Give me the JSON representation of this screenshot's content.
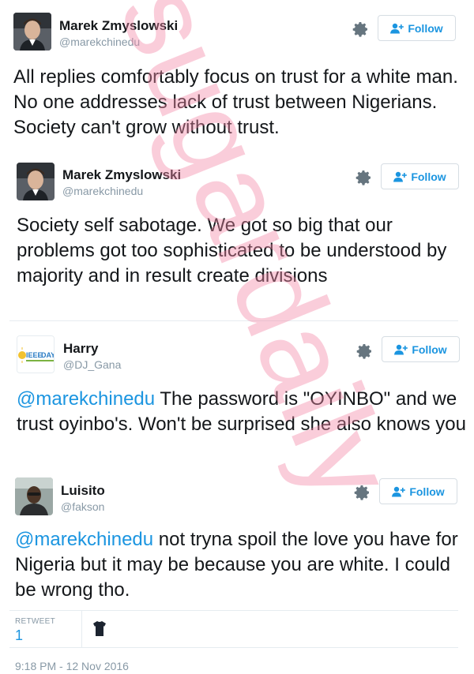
{
  "tweets": [
    {
      "name": "Marek Zmyslowski",
      "handle": "@marekchinedu",
      "follow_label": "Follow",
      "mention": "",
      "text": "All replies comfortably focus on trust for a white man. No one addresses lack of trust between Nigerians. Society can't grow without trust."
    },
    {
      "name": "Marek Zmyslowski",
      "handle": "@marekchinedu",
      "follow_label": "Follow",
      "mention": "",
      "text": "Society self sabotage. We got so big that our problems got too sophisticated to be understood by majority and in result create divisions"
    },
    {
      "name": "Harry",
      "handle": "@DJ_Gana",
      "follow_label": "Follow",
      "avatar_text": "IEEE",
      "avatar_text2": "DAY",
      "mention": "@marekchinedu",
      "text": " The password is \"OYINBO\" and we trust oyinbo's. Won't be surprised she also knows you"
    },
    {
      "name": "Luisito",
      "handle": "@fakson",
      "follow_label": "Follow",
      "mention": "@marekchinedu",
      "text": " not tryna spoil the love you have for Nigeria but it may be because you are white. I could be wrong tho."
    }
  ],
  "stats": {
    "retweet_label": "RETWEET",
    "retweet_count": "1"
  },
  "timestamp": "9:18 PM - 12 Nov 2016",
  "watermark": "sugardaily",
  "colors": {
    "link": "#1b95e0",
    "muted": "#8899a6",
    "watermark": "#f48aa8"
  }
}
